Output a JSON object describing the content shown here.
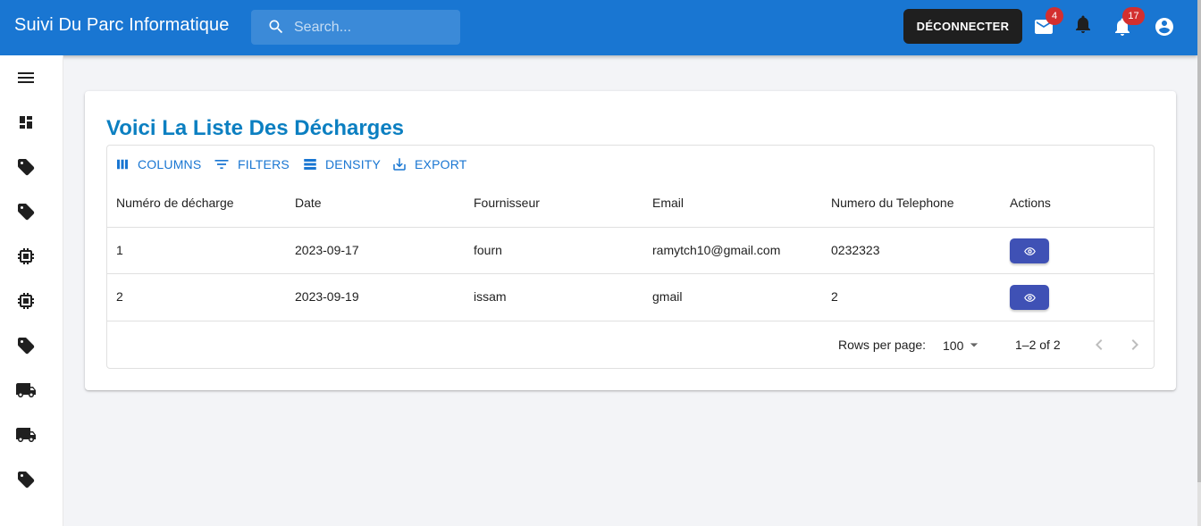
{
  "header": {
    "title": "Suivi Du Parc Informatique",
    "search_placeholder": "Search...",
    "logout_label": "DÉCONNECTER",
    "mail_badge": "4",
    "notifications_badge": "17",
    "brand_color": "#1976d2"
  },
  "sidebar": {
    "items": [
      {
        "icon": "menu-icon"
      },
      {
        "icon": "dashboard-icon"
      },
      {
        "icon": "tag-icon"
      },
      {
        "icon": "tag-icon"
      },
      {
        "icon": "chip-icon"
      },
      {
        "icon": "chip-icon"
      },
      {
        "icon": "tag-icon"
      },
      {
        "icon": "truck-icon"
      },
      {
        "icon": "truck-icon"
      },
      {
        "icon": "tag-icon"
      }
    ]
  },
  "main": {
    "title": "Voici La Liste Des Décharges",
    "toolbar": {
      "columns": "COLUMNS",
      "filters": "FILTERS",
      "density": "DENSITY",
      "export": "EXPORT"
    },
    "columns": [
      "Numéro de décharge",
      "Date",
      "Fournisseur",
      "Email",
      "Numero du Telephone",
      "Actions"
    ],
    "rows": [
      [
        "1",
        "2023-09-17",
        "fourn",
        "ramytch10@gmail.com",
        "0232323"
      ],
      [
        "2",
        "2023-09-19",
        "issam",
        "gmail",
        "2"
      ]
    ],
    "pagination": {
      "rows_per_page_label": "Rows per page:",
      "rows_per_page_value": "100",
      "range": "1–2 of 2"
    }
  }
}
